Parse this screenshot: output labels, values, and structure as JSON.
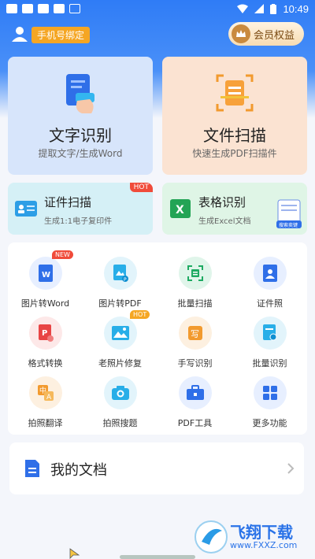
{
  "status_bar": {
    "time": "10:49"
  },
  "header": {
    "bind_phone_label": "手机号绑定",
    "vip_label": "会员权益"
  },
  "big_cards": [
    {
      "title": "文字识别",
      "subtitle": "提取文字/生成Word"
    },
    {
      "title": "文件扫描",
      "subtitle": "快速生成PDF扫描件"
    }
  ],
  "mid_cards": [
    {
      "title": "证件扫描",
      "subtitle": "生成1:1电子复印件",
      "tag": "HOT"
    },
    {
      "title": "表格识别",
      "subtitle": "生成Excel文档",
      "tip": "搜索卖键"
    }
  ],
  "grid": [
    {
      "label": "图片转Word",
      "tag": "NEW",
      "icon": "word-icon"
    },
    {
      "label": "图片转PDF",
      "icon": "pdf-image-icon"
    },
    {
      "label": "批量扫描",
      "icon": "batch-scan-icon"
    },
    {
      "label": "证件照",
      "icon": "id-photo-icon"
    },
    {
      "label": "格式转换",
      "icon": "format-convert-icon"
    },
    {
      "label": "老照片修复",
      "tag": "HOT",
      "icon": "photo-restore-icon"
    },
    {
      "label": "手写识别",
      "icon": "handwriting-icon"
    },
    {
      "label": "批量识别",
      "icon": "batch-recognize-icon"
    },
    {
      "label": "拍照翻译",
      "icon": "translate-icon"
    },
    {
      "label": "拍照搜题",
      "icon": "camera-icon"
    },
    {
      "label": "PDF工具",
      "icon": "toolbox-icon"
    },
    {
      "label": "更多功能",
      "icon": "more-grid-icon"
    }
  ],
  "docs": {
    "title": "我的文档"
  },
  "watermark": {
    "name": "飞翔下载",
    "url": "www.FXXZ.com"
  },
  "colors": {
    "primary": "#2f7cf6",
    "orange": "#f5a623",
    "red": "#f04b3a"
  }
}
